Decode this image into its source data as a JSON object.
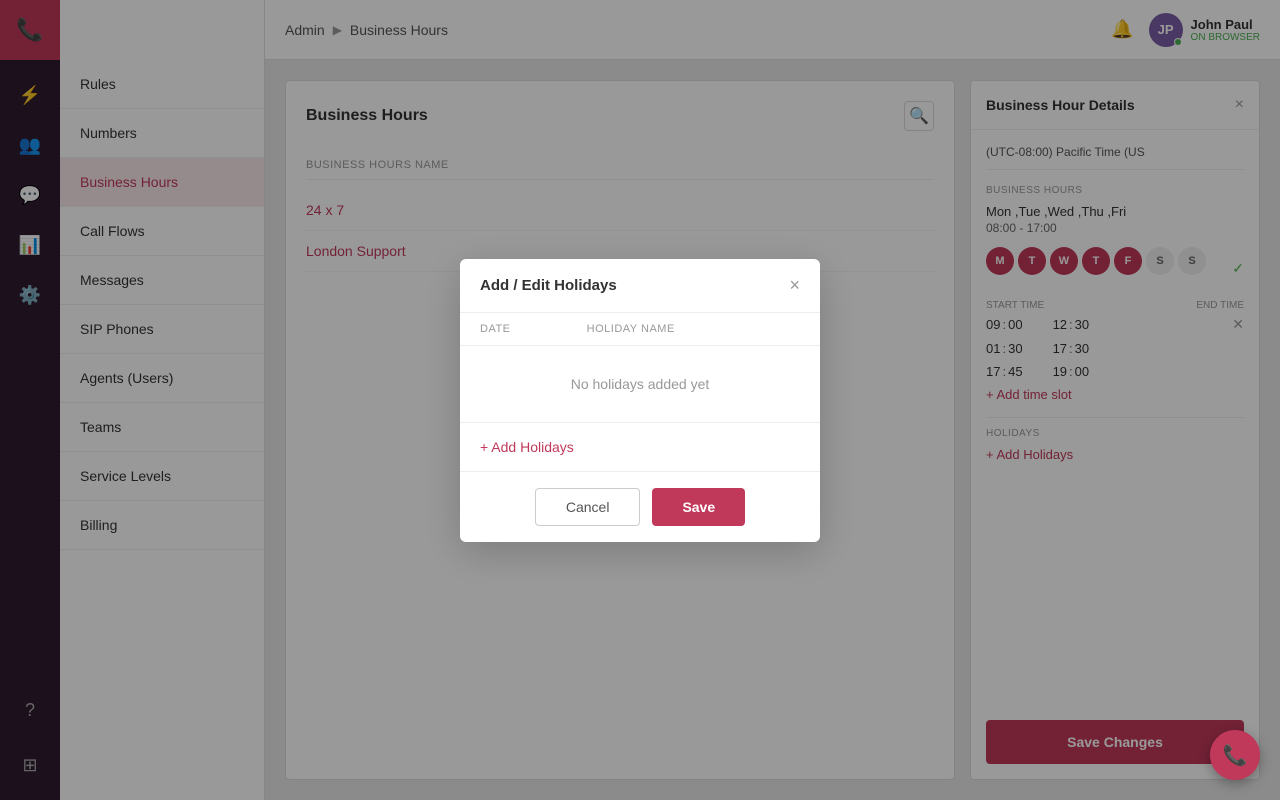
{
  "app": {
    "title": "Business Hours"
  },
  "header": {
    "breadcrumb_root": "Admin",
    "breadcrumb_current": "Business Hours",
    "bell_icon": "bell-icon",
    "user": {
      "name": "John Paul",
      "initials": "JP",
      "status": "ON BROWSER"
    }
  },
  "sidebar": {
    "items": [
      {
        "id": "rules",
        "label": "Rules",
        "active": false
      },
      {
        "id": "numbers",
        "label": "Numbers",
        "active": false
      },
      {
        "id": "business-hours",
        "label": "Business Hours",
        "active": true
      },
      {
        "id": "call-flows",
        "label": "Call Flows",
        "active": false
      },
      {
        "id": "messages",
        "label": "Messages",
        "active": false
      },
      {
        "id": "sip-phones",
        "label": "SIP Phones",
        "active": false
      },
      {
        "id": "agents-users",
        "label": "Agents (Users)",
        "active": false
      },
      {
        "id": "teams",
        "label": "Teams",
        "active": false
      },
      {
        "id": "service-levels",
        "label": "Service Levels",
        "active": false
      },
      {
        "id": "billing",
        "label": "Billing",
        "active": false
      }
    ]
  },
  "business_hours_panel": {
    "title": "Business Hours",
    "col_header": "BUSINESS HOURS NAME",
    "rows": [
      {
        "name": "24 x 7"
      },
      {
        "name": "London Support"
      }
    ]
  },
  "details_panel": {
    "title": "Business Hour Details",
    "close_label": "×",
    "timezone": "(UTC-08:00) Pacific Time (US",
    "business_hours_label": "BUSINESS HOURS",
    "days_display": "Mon ,Tue ,Wed ,Thu ,Fri",
    "hours_display": "08:00 - 17:00",
    "days": [
      {
        "letter": "M",
        "active": true
      },
      {
        "letter": "T",
        "active": true
      },
      {
        "letter": "W",
        "active": true
      },
      {
        "letter": "T",
        "active": true
      },
      {
        "letter": "F",
        "active": true
      },
      {
        "letter": "S",
        "active": false
      },
      {
        "letter": "S",
        "active": false
      }
    ],
    "time_slots": [
      {
        "start_h": "09",
        "start_m": "00",
        "end_h": "12",
        "end_m": "30",
        "removable": true
      },
      {
        "start_h": "01",
        "start_m": "30",
        "end_h": "17",
        "end_m": "30",
        "removable": false
      },
      {
        "start_h": "17",
        "start_m": "45",
        "end_h": "19",
        "end_m": "00",
        "removable": false
      }
    ],
    "start_time_label": "START TIME",
    "end_time_label": "END TIME",
    "add_time_slot_label": "+ Add time slot",
    "holidays_label": "HOLIDAYS",
    "add_holidays_label": "+ Add Holidays",
    "save_changes_label": "Save Changes"
  },
  "modal": {
    "title": "Add / Edit Holidays",
    "col_date": "DATE",
    "col_holiday_name": "HOLIDAY NAME",
    "empty_message": "No holidays added yet",
    "add_label": "+ Add Holidays",
    "cancel_label": "Cancel",
    "save_label": "Save"
  },
  "icons": {
    "phone": "📞",
    "search": "🔍",
    "bell": "🔔",
    "lightning": "⚡",
    "users": "👥",
    "chat": "💬",
    "bar_chart": "📊",
    "settings": "⚙️",
    "help": "?",
    "grid": "⊞"
  }
}
